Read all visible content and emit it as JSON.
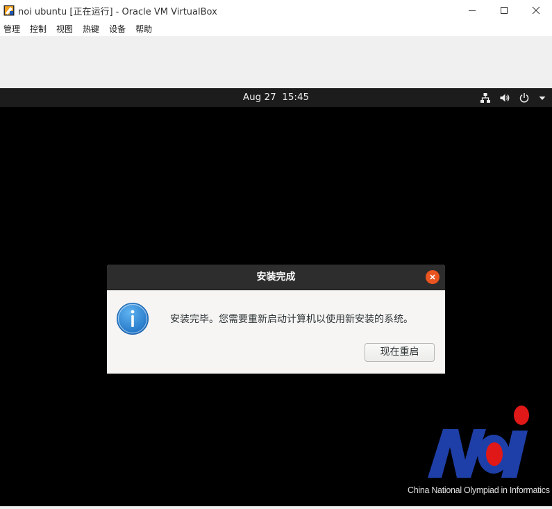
{
  "window": {
    "title": "noi ubuntu [正在运行] - Oracle VM VirtualBox",
    "icon": "virtualbox-app-icon",
    "controls": [
      "minimize-icon",
      "maximize-icon",
      "close-icon"
    ]
  },
  "menubar": {
    "items": [
      {
        "label": "管理"
      },
      {
        "label": "控制"
      },
      {
        "label": "视图"
      },
      {
        "label": "热键"
      },
      {
        "label": "设备"
      },
      {
        "label": "帮助"
      }
    ]
  },
  "guest": {
    "topbar": {
      "clock": "Aug 27  15:45",
      "tray_icons": [
        "network-wired-icon",
        "volume-icon",
        "power-icon",
        "dropdown-arrow-icon"
      ]
    },
    "dialog": {
      "title": "安装完成",
      "message": "安装完毕。您需要重新启动计算机以使用新安装的系统。",
      "button_label": "现在重启",
      "icon": "info-icon",
      "close_icon": "close-icon"
    },
    "logo": {
      "text": "NOI",
      "caption": "China National Olympiad in Informatics"
    }
  },
  "colors": {
    "gnome_topbar": "#1c1c1c",
    "dialog_header": "#2d2d2d",
    "close_accent": "#e95420",
    "info_blue": "#2a88d6",
    "logo_blue": "#1e3fa8",
    "logo_red": "#e01818"
  }
}
